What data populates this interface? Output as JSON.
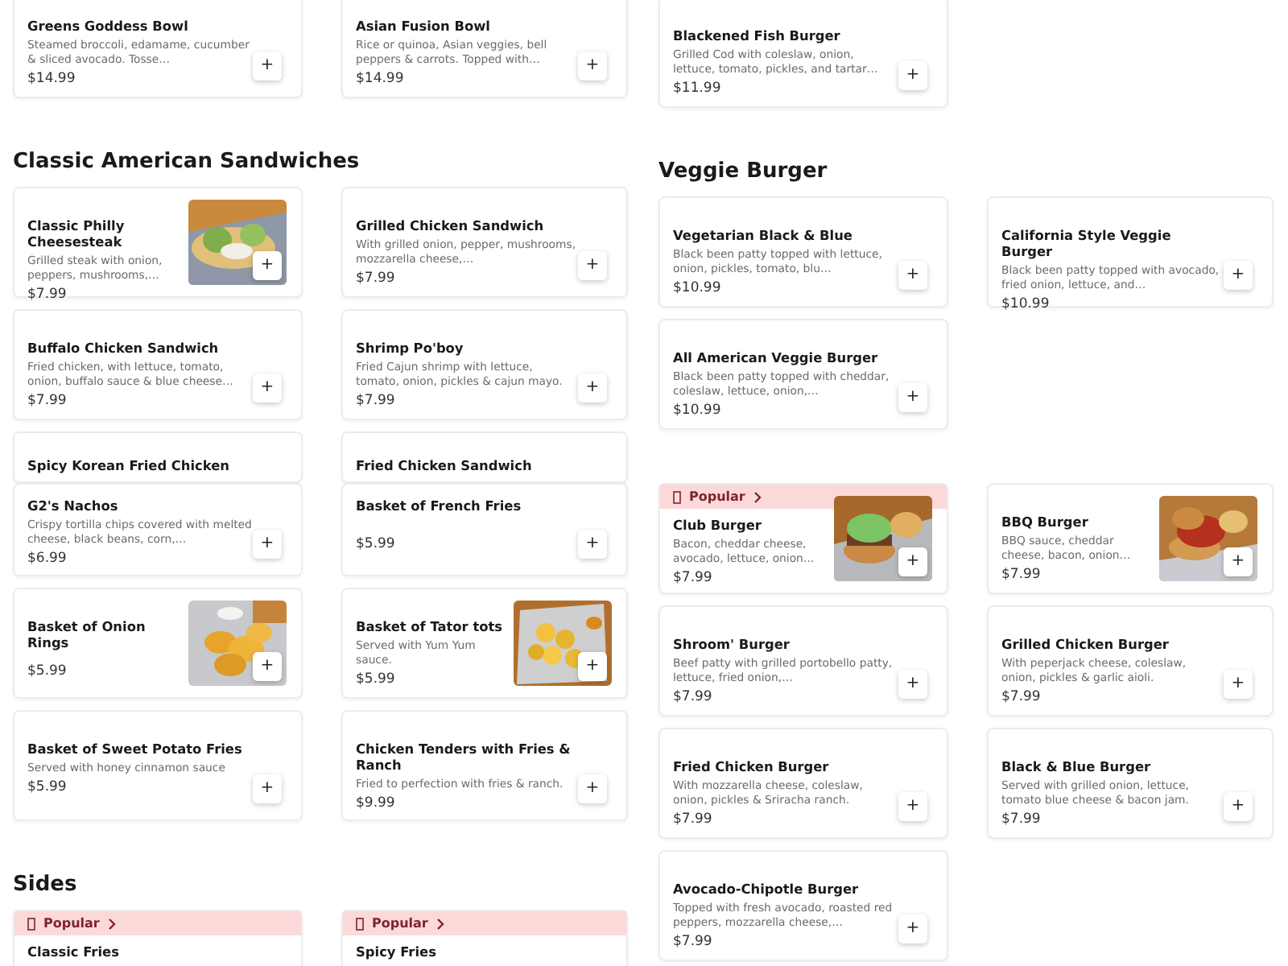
{
  "columns": [
    {
      "blocks": [
        {
          "kind": "row",
          "cards": [
            {
              "kind": "item",
              "title": "Greens Goddess Bowl",
              "description": "Steamed broccoli, edamame, cucumber & sliced avocado. Tosse…",
              "price": "$14.99",
              "button": "+"
            },
            {
              "kind": "item",
              "title": "Asian Fusion Bowl",
              "description": "Rice or quinoa, Asian veggies, bell peppers & carrots. Topped with…",
              "price": "$14.99",
              "button": "+"
            }
          ]
        },
        {
          "kind": "heading",
          "text": "Classic American Sandwiches"
        },
        {
          "kind": "row",
          "cards": [
            {
              "kind": "item",
              "title": "Classic Philly Cheesesteak",
              "description": "Grilled steak with onion, peppers, mushrooms,…",
              "price": "$7.99",
              "button": "+"
            },
            {
              "kind": "item",
              "title": "Grilled Chicken Sandwich",
              "description": "With grilled onion, pepper, mushrooms, mozzarella cheese,…",
              "price": "$7.99",
              "button": "+"
            }
          ]
        },
        {
          "kind": "row",
          "cards": [
            {
              "kind": "item",
              "title": "Buffalo Chicken Sandwich",
              "description": "Fried chicken, with lettuce, tomato, onion, buffalo sauce & blue cheese…",
              "price": "$7.99",
              "button": "+"
            },
            {
              "kind": "item",
              "title": "Shrimp Po'boy",
              "description": "Fried Cajun shrimp with lettuce, tomato, onion, pickles & cajun mayo.",
              "price": "$7.99",
              "button": "+"
            }
          ]
        },
        {
          "kind": "row",
          "cards": [
            {
              "kind": "cut",
              "title": "Spicy Korean Fried Chicken"
            },
            {
              "kind": "cut",
              "title": "Fried Chicken Sandwich"
            }
          ]
        },
        {
          "kind": "row",
          "cards": [
            {
              "kind": "tight",
              "title": "G2's Nachos",
              "description": "Crispy tortilla chips covered with melted cheese, black beans, corn,…",
              "price": "$6.99",
              "button": "+"
            },
            {
              "kind": "tight",
              "title": "Basket of French Fries",
              "price": "$5.99",
              "button": "+"
            }
          ]
        },
        {
          "kind": "row",
          "cards": [
            {
              "kind": "item",
              "title": "Basket of Onion Rings",
              "price": "$5.99",
              "button": "+"
            },
            {
              "kind": "item",
              "title": "Basket of Tator tots",
              "description": "Served with Yum Yum sauce.",
              "price": "$5.99",
              "button": "+"
            }
          ]
        },
        {
          "kind": "row",
          "cards": [
            {
              "kind": "item",
              "title": "Basket of Sweet Potato Fries",
              "description": "Served with honey cinnamon sauce",
              "price": "$5.99",
              "button": "+"
            },
            {
              "kind": "item",
              "title": "Chicken Tenders with Fries & Ranch",
              "description": "Fried to perfection with fries & ranch.",
              "price": "$9.99",
              "button": "+"
            }
          ]
        },
        {
          "kind": "heading",
          "text": "Sides"
        },
        {
          "kind": "row",
          "cards": [
            {
              "kind": "item",
              "badge": "Popular",
              "title": "Classic Fries"
            },
            {
              "kind": "item",
              "badge": "Popular",
              "title": "Spicy Fries"
            }
          ]
        }
      ]
    },
    {
      "blocks": [
        {
          "kind": "row",
          "cards": [
            {
              "kind": "item",
              "title": "Blackened Fish Burger",
              "description": "Grilled Cod with coleslaw, onion, lettuce, tomato, pickles, and tartar…",
              "price": "$11.99",
              "button": "+"
            }
          ]
        },
        {
          "kind": "heading",
          "text": "Veggie Burger"
        },
        {
          "kind": "row",
          "cards": [
            {
              "kind": "item",
              "title": "Vegetarian Black & Blue",
              "description": "Black been patty topped with lettuce, onion, pickles, tomato, blu…",
              "price": "$10.99",
              "button": "+"
            },
            {
              "kind": "item",
              "title": "California Style Veggie Burger",
              "description": "Black been patty topped with avocado, fried onion, lettuce, and…",
              "price": "$10.99",
              "button": "+"
            }
          ]
        },
        {
          "kind": "row",
          "cards": [
            {
              "kind": "item",
              "title": "All American Veggie Burger",
              "description": "Black been patty topped with cheddar, coleslaw, lettuce, onion,…",
              "price": "$10.99",
              "button": "+"
            }
          ]
        },
        {
          "kind": "row",
          "cards": [
            {
              "kind": "item",
              "badge": "Popular",
              "title": "Club Burger",
              "description": "Bacon, cheddar cheese, avocado, lettuce, onion…",
              "price": "$7.99",
              "button": "+"
            },
            {
              "kind": "item",
              "title": "BBQ Burger",
              "description": "BBQ sauce, cheddar cheese, bacon, onion…",
              "price": "$7.99",
              "button": "+"
            }
          ]
        },
        {
          "kind": "row",
          "cards": [
            {
              "kind": "item",
              "title": "Shroom' Burger",
              "description": "Beef patty with grilled portobello patty, lettuce, fried onion,…",
              "price": "$7.99",
              "button": "+"
            },
            {
              "kind": "item",
              "title": "Grilled Chicken Burger",
              "description": "With peperjack cheese, coleslaw, onion, pickles & garlic aioli.",
              "price": "$7.99",
              "button": "+"
            }
          ]
        },
        {
          "kind": "row",
          "cards": [
            {
              "kind": "item",
              "title": "Fried Chicken Burger",
              "description": "With mozzarella cheese, coleslaw, onion, pickles & Sriracha ranch.",
              "price": "$7.99",
              "button": "+"
            },
            {
              "kind": "item",
              "title": "Black & Blue Burger",
              "description": "Served with grilled onion, lettuce, tomato blue cheese & bacon jam.",
              "price": "$7.99",
              "button": "+"
            }
          ]
        },
        {
          "kind": "row",
          "cards": [
            {
              "kind": "item",
              "title": "Avocado-Chipotle Burger",
              "description": "Topped with fresh avocado, roasted red peppers, mozzarella cheese,…",
              "price": "$7.99",
              "button": "+"
            }
          ]
        }
      ]
    }
  ]
}
